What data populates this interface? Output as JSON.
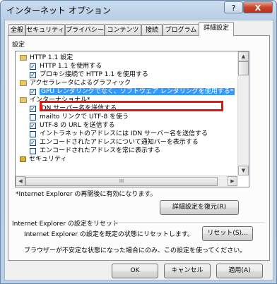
{
  "window": {
    "title": "インターネット オプション",
    "help_label": "?",
    "close_label": "X"
  },
  "tabs": [
    {
      "label": "全般",
      "active": false
    },
    {
      "label": "セキュリティ",
      "active": false
    },
    {
      "label": "プライバシー",
      "active": false
    },
    {
      "label": "コンテンツ",
      "active": false
    },
    {
      "label": "接続",
      "active": false
    },
    {
      "label": "プログラム",
      "active": false
    },
    {
      "label": "詳細設定",
      "active": true
    }
  ],
  "settings": {
    "group_label": "設定",
    "items": [
      {
        "label": "HTTP 1.1 設定",
        "type": "folder",
        "checked": false
      },
      {
        "label": "HTTP 1.1 を使用する",
        "type": "checkbox",
        "checked": true
      },
      {
        "label": "プロキシ接続で HTTP 1.1 を使用する",
        "type": "checkbox",
        "checked": true
      },
      {
        "label": "アクセラレータによるグラフィック",
        "type": "folder",
        "checked": false
      },
      {
        "label": "GPU レンダリングでなく、ソフトウェア レンダリングを使用する*",
        "type": "checkbox",
        "checked": true,
        "selected": true
      },
      {
        "label": "インターナショナル*",
        "type": "folder",
        "checked": false
      },
      {
        "label": "IDN サーバー名を送信する",
        "type": "checkbox",
        "checked": true
      },
      {
        "label": "mailto リンクで UTF-8 を使う",
        "type": "checkbox",
        "checked": false
      },
      {
        "label": "UTF-8 の URL を送信する",
        "type": "checkbox",
        "checked": true
      },
      {
        "label": "イントラネットのアドレスには IDN サーバー名を送信する",
        "type": "checkbox",
        "checked": false
      },
      {
        "label": "エンコードされたアドレスについて通知バーを表示する",
        "type": "checkbox",
        "checked": true
      },
      {
        "label": "エンコードされたアドレスを常に表示する",
        "type": "checkbox",
        "checked": false
      },
      {
        "label": "セキュリティ",
        "type": "lock-folder",
        "checked": false
      }
    ],
    "scroll_mark": "III"
  },
  "restart_note": "*Internet Explorer の再開後に有効になります。",
  "restore_button": "詳細設定を復元(R)",
  "reset_section": {
    "title": "Internet Explorer の設定をリセット",
    "description": "Internet Explorer の設定を既定の状態にリセットします。",
    "reset_button": "リセット(S)...",
    "note": "ブラウザーが不安定な状態になった場合にのみ、この設定を使ってください。"
  },
  "footer": {
    "ok": "OK",
    "cancel": "キャンセル",
    "apply": "適用(A)"
  }
}
